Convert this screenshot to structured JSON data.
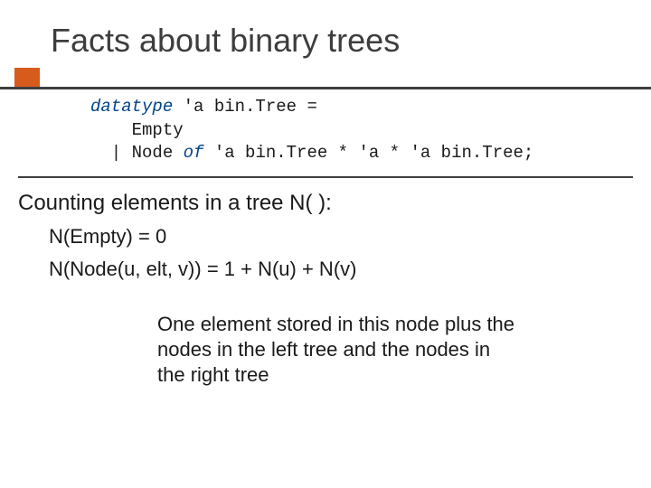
{
  "title": "Facts about binary trees",
  "code": {
    "kw_datatype": "datatype",
    "line1_rest": " 'a bin.Tree =",
    "line2": "    Empty",
    "line3_pre": "  | Node ",
    "kw_of": "of",
    "line3_rest": " 'a bin.Tree * 'a * 'a bin.Tree;"
  },
  "subheading": "Counting elements in a tree N( ):",
  "eq1": "N(Empty)             = 0",
  "eq2": "N(Node(u, elt, v)) = 1 + N(u) + N(v)",
  "explanation": "One element stored in this node plus the nodes in the left tree and the nodes in the right tree"
}
